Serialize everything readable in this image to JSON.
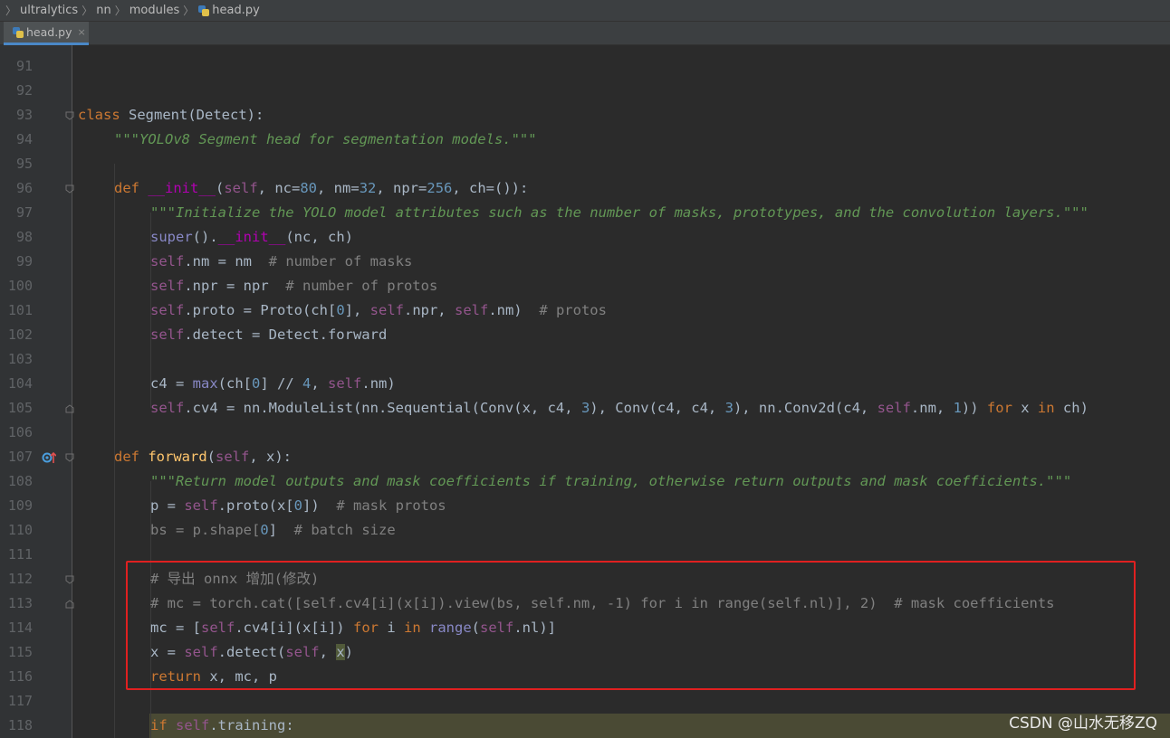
{
  "breadcrumb": {
    "items": [
      "ultralytics",
      "nn",
      "modules",
      "head.py"
    ]
  },
  "tab": {
    "label": "head.py",
    "close": "×"
  },
  "editor": {
    "lines": [
      {
        "n": "91"
      },
      {
        "n": "92"
      },
      {
        "n": "93"
      },
      {
        "n": "94"
      },
      {
        "n": "95"
      },
      {
        "n": "96"
      },
      {
        "n": "97"
      },
      {
        "n": "98"
      },
      {
        "n": "99"
      },
      {
        "n": "100"
      },
      {
        "n": "101"
      },
      {
        "n": "102"
      },
      {
        "n": "103"
      },
      {
        "n": "104"
      },
      {
        "n": "105"
      },
      {
        "n": "106"
      },
      {
        "n": "107"
      },
      {
        "n": "108"
      },
      {
        "n": "109"
      },
      {
        "n": "110"
      },
      {
        "n": "111"
      },
      {
        "n": "112"
      },
      {
        "n": "113"
      },
      {
        "n": "114"
      },
      {
        "n": "115"
      },
      {
        "n": "116"
      },
      {
        "n": "117"
      },
      {
        "n": "118"
      }
    ],
    "code": {
      "l93_kw": "class",
      "l93_rest": " Segment(Detect):",
      "l94": "\"\"\"YOLOv8 Segment head for segmentation models.\"\"\"",
      "l96_kw": "def",
      "l96_name": "__init__",
      "l96_self": "self",
      "l96_a": ", nc=",
      "l96_n1": "80",
      "l96_b": ", nm=",
      "l96_n2": "32",
      "l96_c": ", npr=",
      "l96_n3": "256",
      "l96_d": ", ch=()):",
      "l97": "\"\"\"Initialize the YOLO model attributes such as the number of masks, prototypes, and the convolution layers.\"\"\"",
      "l98_a": "super",
      "l98_b": "().",
      "l98_c": "__init__",
      "l98_d": "(nc, ch)",
      "l99_self": "self",
      "l99_rest": ".nm = nm  ",
      "l99_cm": "# number of masks",
      "l100_self": "self",
      "l100_rest": ".npr = npr  ",
      "l100_cm": "# number of protos",
      "l101_self": "self",
      "l101_a": ".proto = Proto(ch[",
      "l101_n": "0",
      "l101_b": "], ",
      "l101_self2": "self",
      "l101_c": ".npr, ",
      "l101_self3": "self",
      "l101_d": ".nm)  ",
      "l101_cm": "# protos",
      "l102_self": "self",
      "l102_rest": ".detect = Detect.forward",
      "l104_a": "c4 = ",
      "l104_b": "max",
      "l104_c": "(ch[",
      "l104_n": "0",
      "l104_d": "] // ",
      "l104_n2": "4",
      "l104_e": ", ",
      "l104_self": "self",
      "l104_f": ".nm)",
      "l105_self": "self",
      "l105_a": ".cv4 = nn.ModuleList(nn.Sequential(Conv(x, c4, ",
      "l105_n1": "3",
      "l105_b": "), Conv(c4, c4, ",
      "l105_n2": "3",
      "l105_c": "), nn.Conv2d(c4, ",
      "l105_self2": "self",
      "l105_d": ".nm, ",
      "l105_n3": "1",
      "l105_e": ")) ",
      "l105_for": "for",
      "l105_f": " x ",
      "l105_in": "in",
      "l105_g": " ch)",
      "l107_kw": "def",
      "l107_name": "forward",
      "l107_a": "(",
      "l107_self": "self",
      "l107_b": ", x):",
      "l108": "\"\"\"Return model outputs and mask coefficients if training, otherwise return outputs and mask coefficients.\"\"\"",
      "l109_a": "p = ",
      "l109_self": "self",
      "l109_b": ".proto(x[",
      "l109_n": "0",
      "l109_c": "])  ",
      "l109_cm": "# mask protos",
      "l110_a": "bs = p.shape[",
      "l110_n": "0",
      "l110_b": "]  ",
      "l110_cm": "# batch size",
      "l112": "# 导出 onnx 增加(修改)",
      "l113": "# mc = torch.cat([self.cv4[i](x[i]).view(bs, self.nm, -1) for i in range(self.nl)], 2)  # mask coefficients",
      "l114_a": "mc = [",
      "l114_self": "self",
      "l114_b": ".cv4[i](x[i]) ",
      "l114_for": "for",
      "l114_c": " i ",
      "l114_in": "in",
      "l114_d": " ",
      "l114_range": "range",
      "l114_e": "(",
      "l114_self2": "self",
      "l114_f": ".nl)]",
      "l115_a": "x = ",
      "l115_self": "self",
      "l115_b": ".detect(",
      "l115_self2": "self",
      "l115_c": ", ",
      "l115_x": "x",
      "l115_d": ")",
      "l116_kw": "return",
      "l116_rest": " x, mc, p",
      "l118_kw": "if",
      "l118_sp": " ",
      "l118_self": "self",
      "l118_rest": ".training:"
    }
  },
  "watermark": "CSDN @山水无移ZQ",
  "colors": {
    "background": "#2b2b2b",
    "keyword": "#cc7832",
    "self": "#94558d",
    "number": "#6897bb",
    "comment": "#808080",
    "docstring": "#629755",
    "highlight_box": "#e02020"
  }
}
